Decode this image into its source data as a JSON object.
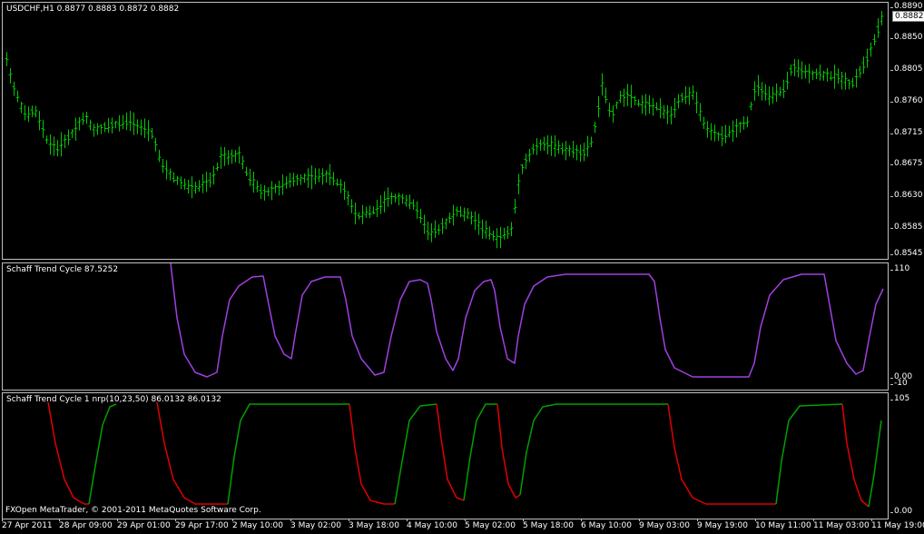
{
  "main": {
    "title": "USDCHF,H1  0.8877 0.8883 0.8872 0.8882",
    "current_price": "0.8882",
    "price_scale": [
      "0.8890",
      "0.8850",
      "0.8805",
      "0.8760",
      "0.8715",
      "0.8675",
      "0.8630",
      "0.8585",
      "0.8545"
    ],
    "bar_color": "#00c800"
  },
  "stc": {
    "title": "Schaff Trend Cycle 87.5252",
    "scale": [
      "110",
      "0.00",
      "-10"
    ],
    "line_color": "#a040e0"
  },
  "stc1": {
    "title": "Schaff Trend Cycle 1 nrp(10,23,50) 86.0132 86.0132",
    "scale": [
      "105",
      "0.00"
    ],
    "up_color": "#00a000",
    "down_color": "#e00000"
  },
  "time_axis": [
    "27 Apr 2011",
    "28 Apr 09:00",
    "29 Apr 01:00",
    "29 Apr 17:00",
    "2 May 10:00",
    "3 May 02:00",
    "3 May 18:00",
    "4 May 10:00",
    "5 May 02:00",
    "5 May 18:00",
    "6 May 10:00",
    "9 May 03:00",
    "9 May 19:00",
    "10 May 11:00",
    "11 May 03:00",
    "11 May 19:00"
  ],
  "copyright": "FXOpen MetaTrader, © 2001-2011 MetaQuotes Software Corp."
}
